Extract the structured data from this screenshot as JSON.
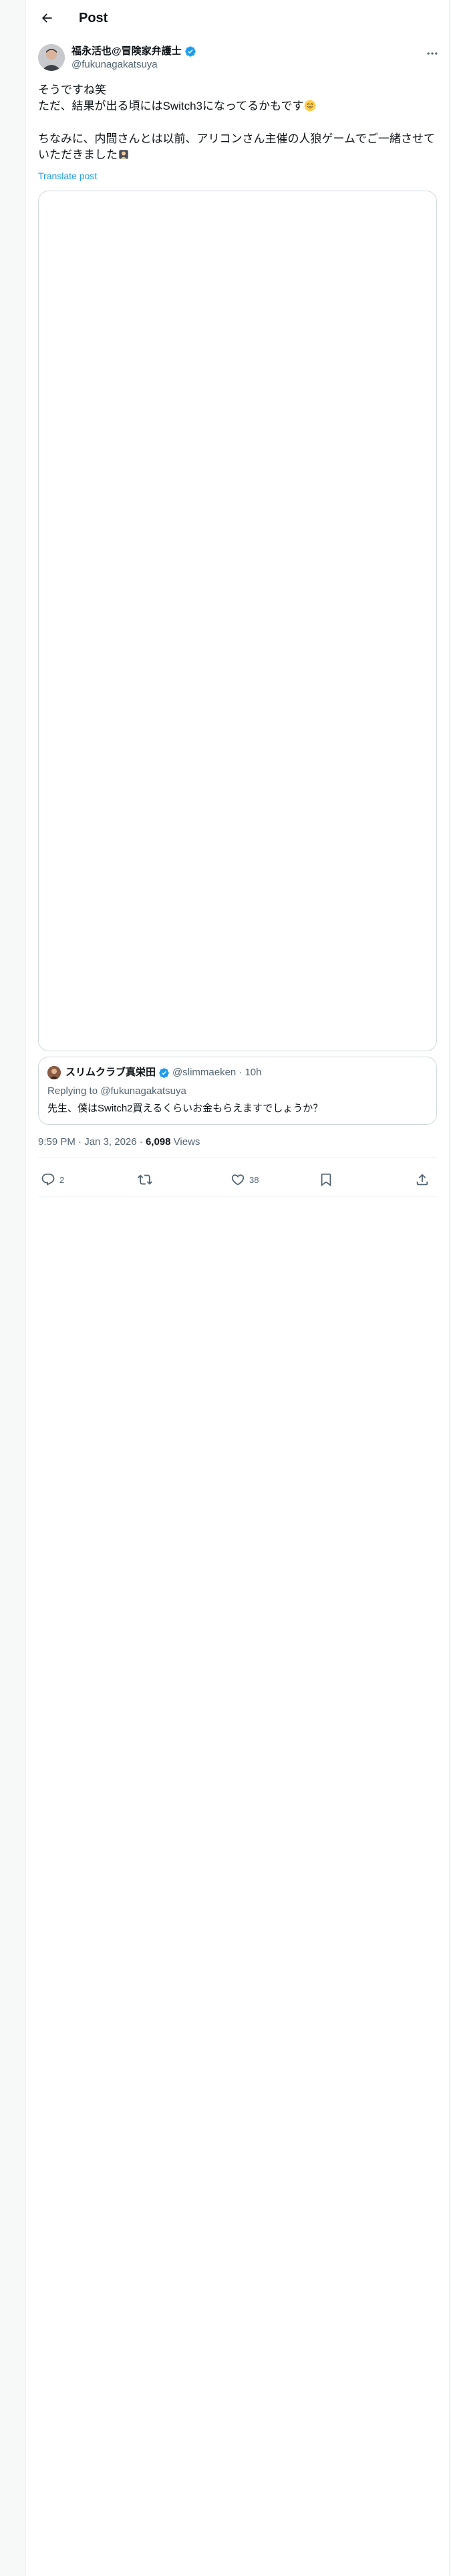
{
  "header": {
    "title": "Post"
  },
  "author": {
    "name": "福永活也@冒険家弁護士",
    "handle": "@fukunagakatsuya",
    "verified": true
  },
  "tweet": {
    "line1": "そうですね笑",
    "line2": "ただ、結果が出る頃にはSwitch3になってるかもです",
    "line3": "ちなみに、内間さんとは以前、アリコンさん主催の人狼ゲームでご一緒させていただきました",
    "translate_label": "Translate post"
  },
  "quote": {
    "name": "スリムクラブ真栄田",
    "handle": "@slimmaeken",
    "time": "· 10h",
    "replying_prefix": "Replying to",
    "replying_handle": "@fukunagakatsuya",
    "text": "先生、僕はSwitch2買えるくらいお金もらえますでしょうか？"
  },
  "meta": {
    "time_date": "9:59 PM · Jan 3, 2026 ·",
    "views_count": "6,098",
    "views_label": "Views"
  },
  "actions": {
    "replies": "2",
    "reposts": "",
    "likes": "38"
  },
  "colors": {
    "accent": "#1d9bf0",
    "text": "#0f1419",
    "secondary": "#536471",
    "border": "#cfd9de"
  },
  "icons": [
    "back-arrow-icon",
    "verified-badge-icon",
    "more-icon",
    "reply-icon",
    "repost-icon",
    "like-icon",
    "bookmark-icon",
    "share-icon"
  ]
}
